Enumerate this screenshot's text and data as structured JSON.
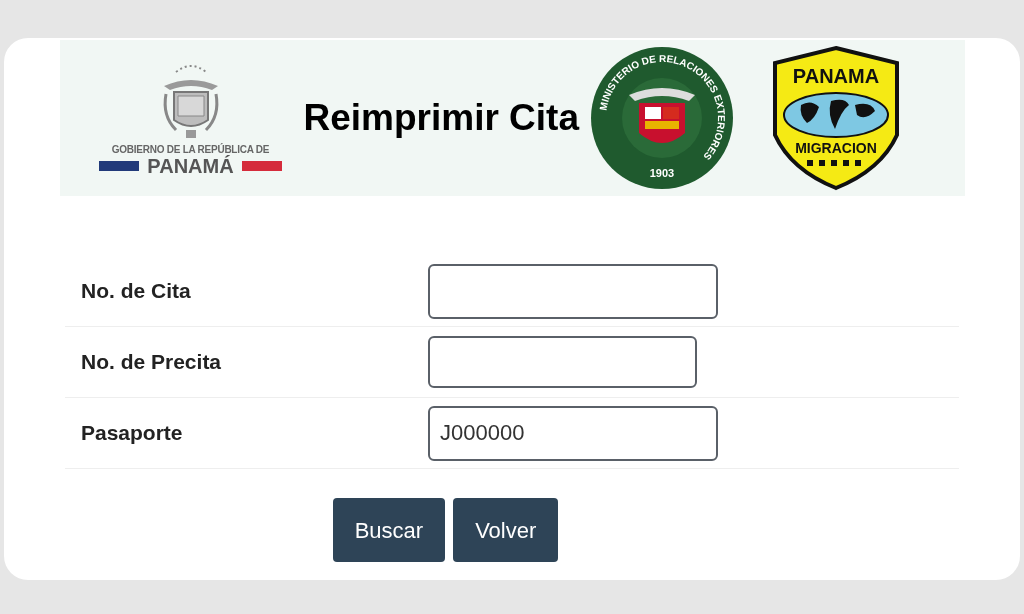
{
  "header": {
    "gov_logo": {
      "line_1": "GOBIERNO DE LA REPÚBLICA DE",
      "line_2": "PANAMÁ"
    },
    "title": "Reimprimir Cita",
    "ministry_seal": {
      "ring_text": "MINISTERIO DE RELACIONES EXTERIORES",
      "year": "1903"
    },
    "migration_badge": {
      "top": "PANAMA",
      "bottom": "MIGRACION"
    }
  },
  "fields": [
    {
      "label": "No. de Cita",
      "kind": "wide"
    },
    {
      "label": "No. de Precita",
      "kind": "narrow"
    },
    {
      "label": "Pasaporte",
      "value": "J000000",
      "kind": "wide"
    }
  ],
  "buttons": [
    "Buscar",
    "Volver"
  ]
}
